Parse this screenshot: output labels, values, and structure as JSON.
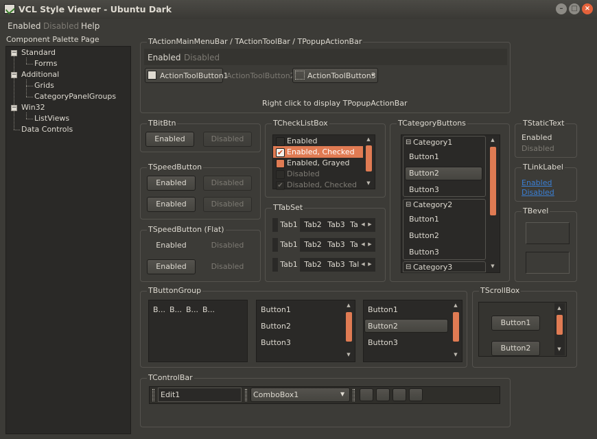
{
  "window": {
    "title": "VCL Style Viewer - Ubuntu Dark"
  },
  "menu": {
    "enabled": "Enabled",
    "disabled": "Disabled",
    "help": "Help"
  },
  "tree": {
    "header": "Component Palette Page",
    "nodes": [
      {
        "label": "Standard",
        "level": 0,
        "expand": "−"
      },
      {
        "label": "Forms",
        "level": 1
      },
      {
        "label": "Additional",
        "level": 0,
        "expand": "−"
      },
      {
        "label": "Grids",
        "level": 1
      },
      {
        "label": "CategoryPanelGroups",
        "level": 1
      },
      {
        "label": "Win32",
        "level": 0,
        "expand": "−"
      },
      {
        "label": "ListViews",
        "level": 1
      },
      {
        "label": "Data Controls",
        "level": 0
      }
    ]
  },
  "action_bars": {
    "title": "TActionMainMenuBar / TActionToolBar / TPopupActionBar",
    "menu_enabled": "Enabled",
    "menu_disabled": "Disabled",
    "tool1": "ActionToolButton1",
    "tool2": "ActionToolButton2",
    "tool3": "ActionToolButton3",
    "hint": "Right click to display TPopupActionBar"
  },
  "bitbtn": {
    "title": "TBitBtn",
    "enabled": "Enabled",
    "disabled": "Disabled"
  },
  "speedbutton": {
    "title": "TSpeedButton",
    "enabled": "Enabled",
    "disabled": "Disabled"
  },
  "speedbutton_flat": {
    "title": "TSpeedButton (Flat)",
    "enabled": "Enabled",
    "disabled": "Disabled"
  },
  "checklistbox": {
    "title": "TCheckListBox",
    "items": [
      {
        "label": "Enabled",
        "state": "unchecked"
      },
      {
        "label": "Enabled, Checked",
        "state": "checked"
      },
      {
        "label": "Enabled, Grayed",
        "state": "grayed"
      },
      {
        "label": "Disabled",
        "state": "disabled"
      },
      {
        "label": "Disabled, Checked",
        "state": "disabled-checked"
      }
    ]
  },
  "tabset": {
    "title": "TTabSet",
    "tabs": [
      "Tab1",
      "Tab2",
      "Tab3",
      "Ta"
    ],
    "tabs3": [
      "Tab1",
      "Tab2",
      "Tab3",
      "Tal"
    ]
  },
  "category_buttons": {
    "title": "TCategoryButtons",
    "categories": [
      {
        "name": "Category1",
        "buttons": [
          "Button1",
          "Button2",
          "Button3"
        ]
      },
      {
        "name": "Category2",
        "buttons": [
          "Button1",
          "Button2",
          "Button3"
        ]
      },
      {
        "name": "Category3",
        "buttons": []
      }
    ]
  },
  "static_text": {
    "title": "TStaticText",
    "enabled": "Enabled",
    "disabled": "Disabled"
  },
  "link_label": {
    "title": "TLinkLabel",
    "enabled": "Enabled",
    "disabled": "Disabled"
  },
  "bevel": {
    "title": "TBevel"
  },
  "button_group": {
    "title": "TButtonGroup",
    "compact": [
      "B...",
      "B...",
      "B...",
      "B..."
    ],
    "list1": [
      "Button1",
      "Button2",
      "Button3"
    ],
    "list2": [
      "Button1",
      "Button2",
      "Button3"
    ]
  },
  "scroll_box": {
    "title": "TScrollBox",
    "b1": "Button1",
    "b2": "Button2"
  },
  "control_bar": {
    "title": "TControlBar",
    "edit": "Edit1",
    "combo": "ComboBox1"
  },
  "colors": {
    "accent": "#e07b53",
    "background": "#3c3b37",
    "panel": "#2a2927",
    "link": "#3a7fd4"
  }
}
